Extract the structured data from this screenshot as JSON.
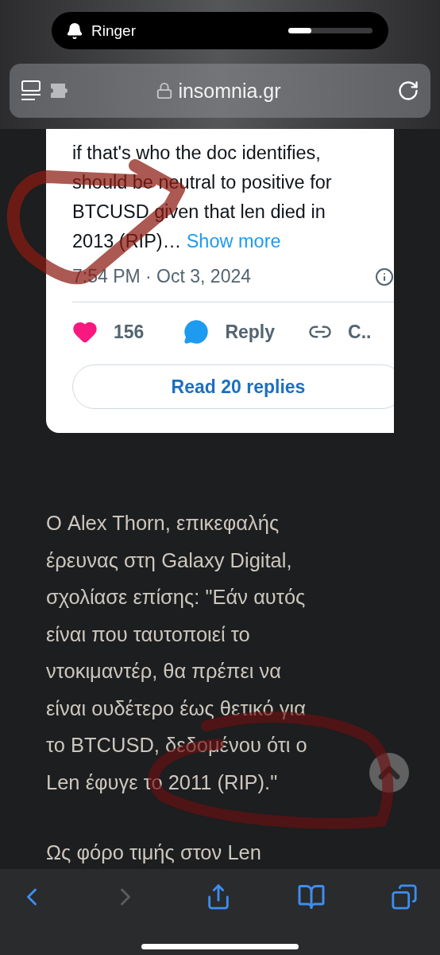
{
  "status_pill": {
    "label": "Ringer",
    "level": 0.27
  },
  "address_bar": {
    "url": "insomnia.gr"
  },
  "tweet": {
    "text_lines": [
      "if that's who the doc identifies,",
      "should be neutral to positive for",
      "BTCUSD given that len died in",
      "2013 (RIP)…"
    ],
    "show_more": "Show more",
    "timestamp": "7:54 PM · Oct 3, 2024",
    "likes": "156",
    "liked": true,
    "reply": "Reply",
    "copy": "C..",
    "read_replies": "Read 20 replies"
  },
  "article": {
    "paragraphs": [
      [
        "Ο Alex Thorn, επικεφαλής",
        "έρευνας στη Galaxy Digital,",
        "σχολίασε επίσης: \"Εάν αυτός",
        "είναι που ταυτοποιεί το",
        "ντοκιμαντέρ, θα πρέπει να",
        "είναι ουδέτερο έως θετικό για",
        "το BTCUSD, δεδομένου ότι ο",
        "Len έφυγε το 2011 (RIP).\""
      ],
      [
        "Ως φόρο τιμής στον Len"
      ]
    ]
  },
  "toolbar": {
    "back_disabled": false,
    "forward_disabled": true
  }
}
